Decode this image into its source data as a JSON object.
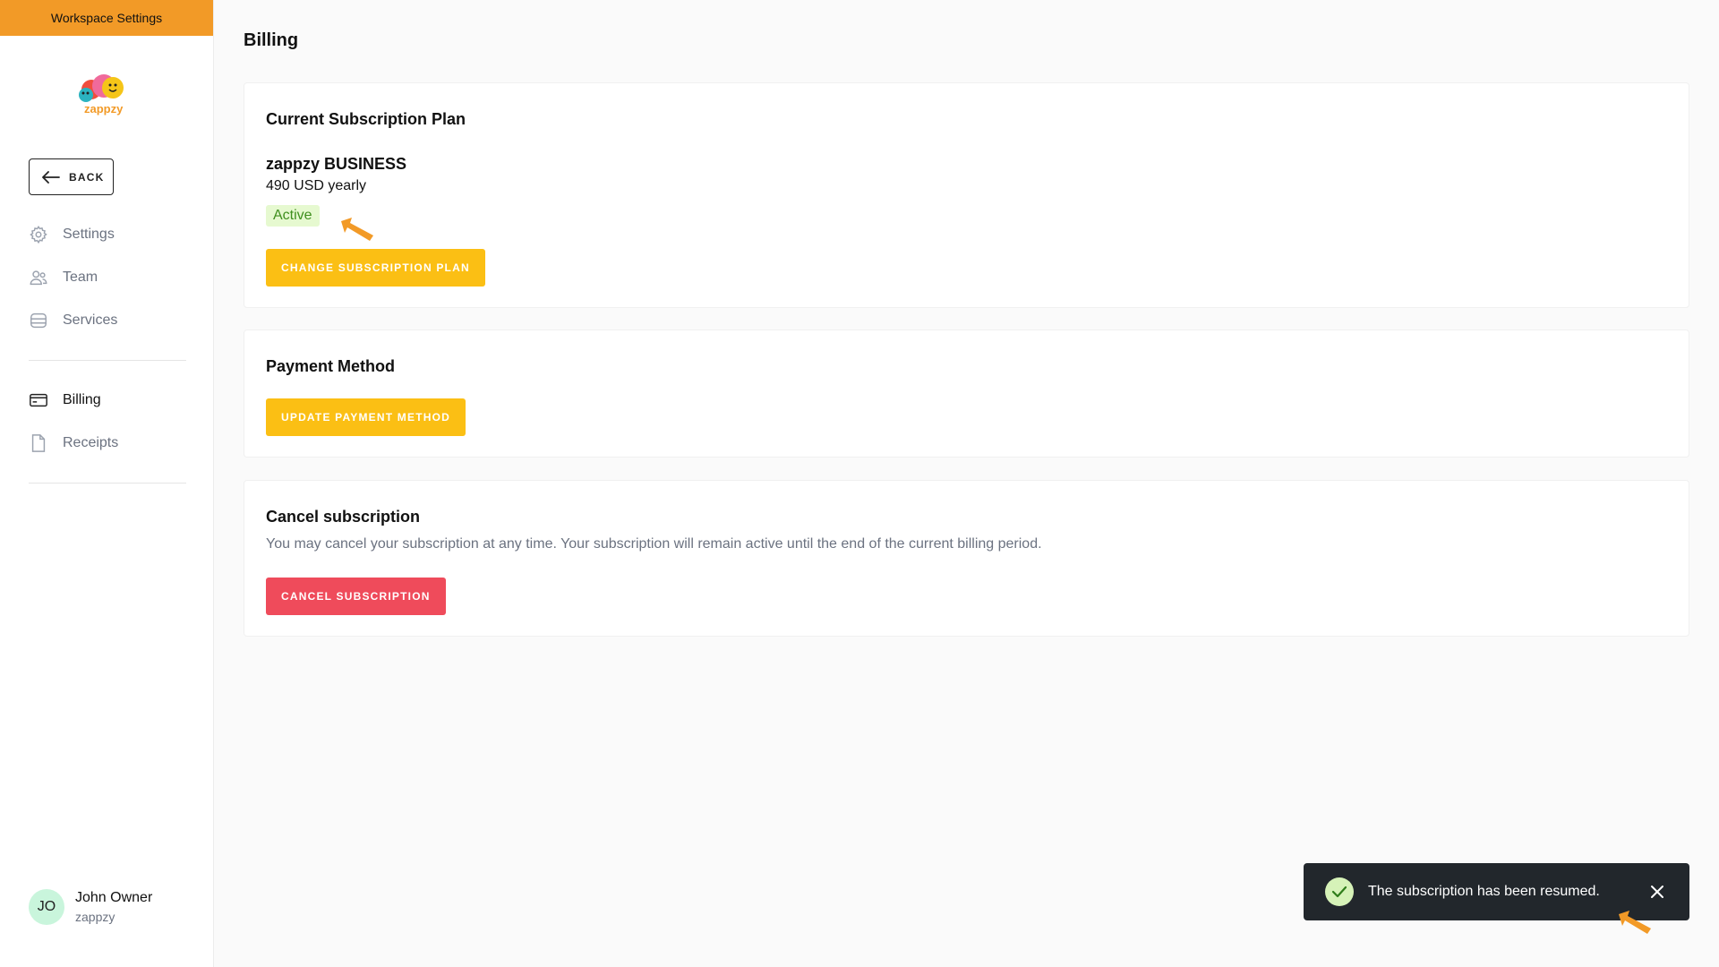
{
  "sidebar": {
    "workspace_header": "Workspace Settings",
    "logo_text": "zappzy",
    "back_label": "BACK",
    "items": [
      {
        "label": "Settings",
        "icon": "gear-icon"
      },
      {
        "label": "Team",
        "icon": "users-icon"
      },
      {
        "label": "Services",
        "icon": "database-icon"
      },
      {
        "label": "Billing",
        "icon": "credit-card-icon",
        "active": true
      },
      {
        "label": "Receipts",
        "icon": "document-icon"
      }
    ],
    "user": {
      "initials": "JO",
      "name": "John Owner",
      "org": "zappzy"
    }
  },
  "main": {
    "title": "Billing",
    "subscription": {
      "heading": "Current Subscription Plan",
      "plan_name": "zappzy BUSINESS",
      "price": "490 USD yearly",
      "status": "Active",
      "change_button": "CHANGE SUBSCRIPTION PLAN"
    },
    "payment": {
      "heading": "Payment Method",
      "update_button": "UPDATE PAYMENT METHOD"
    },
    "cancel": {
      "heading": "Cancel subscription",
      "description": "You may cancel your subscription at any time. Your subscription will remain active until the end of the current billing period.",
      "cancel_button": "CANCEL SUBSCRIPTION"
    }
  },
  "toast": {
    "message": "The subscription has been resumed.",
    "icon": "check-icon",
    "close_icon": "close-icon"
  },
  "colors": {
    "accent_orange": "#f29a27",
    "button_yellow": "#fbbf14",
    "button_red": "#ef4b5b",
    "status_green_bg": "#e6f9d0",
    "toast_bg": "#22272c"
  }
}
